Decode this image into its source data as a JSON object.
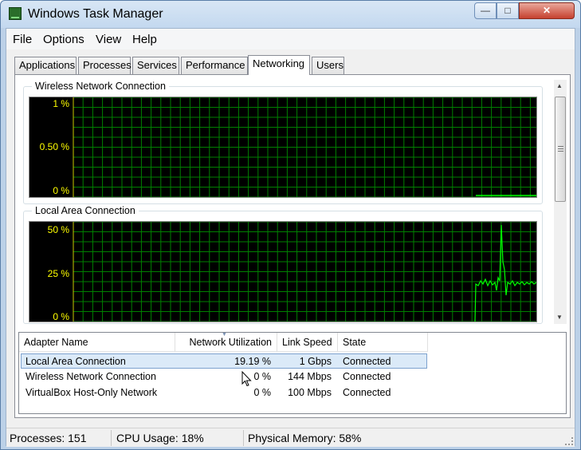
{
  "window": {
    "title": "Windows Task Manager"
  },
  "title_buttons": {
    "minimize": "—",
    "maximize": "□",
    "close": "✕"
  },
  "menu": [
    "File",
    "Options",
    "View",
    "Help"
  ],
  "tabs": [
    "Applications",
    "Processes",
    "Services",
    "Performance",
    "Networking",
    "Users"
  ],
  "active_tab": "Networking",
  "graphs": [
    {
      "name": "Wireless Network Connection",
      "ylabels": [
        "1 %",
        "0.50 %",
        "0 %"
      ]
    },
    {
      "name": "Local Area Connection",
      "ylabels": [
        "50 %",
        "25 %",
        "0 %"
      ]
    }
  ],
  "colors": {
    "grid": "#008000",
    "trace": "#00ff00",
    "axis_label": "#ffff00"
  },
  "table": {
    "columns": [
      "Adapter Name",
      "Network Utilization",
      "Link Speed",
      "State"
    ],
    "rows": [
      {
        "name": "Local Area Connection",
        "util": "19.19 %",
        "speed": "1 Gbps",
        "state": "Connected"
      },
      {
        "name": "Wireless Network Connection",
        "util": "0 %",
        "speed": "144 Mbps",
        "state": "Connected"
      },
      {
        "name": "VirtualBox Host-Only Network",
        "util": "0 %",
        "speed": "100 Mbps",
        "state": "Connected"
      }
    ]
  },
  "status": {
    "processes": "Processes: 151",
    "cpu": "CPU Usage: 18%",
    "memory": "Physical Memory: 58%"
  }
}
